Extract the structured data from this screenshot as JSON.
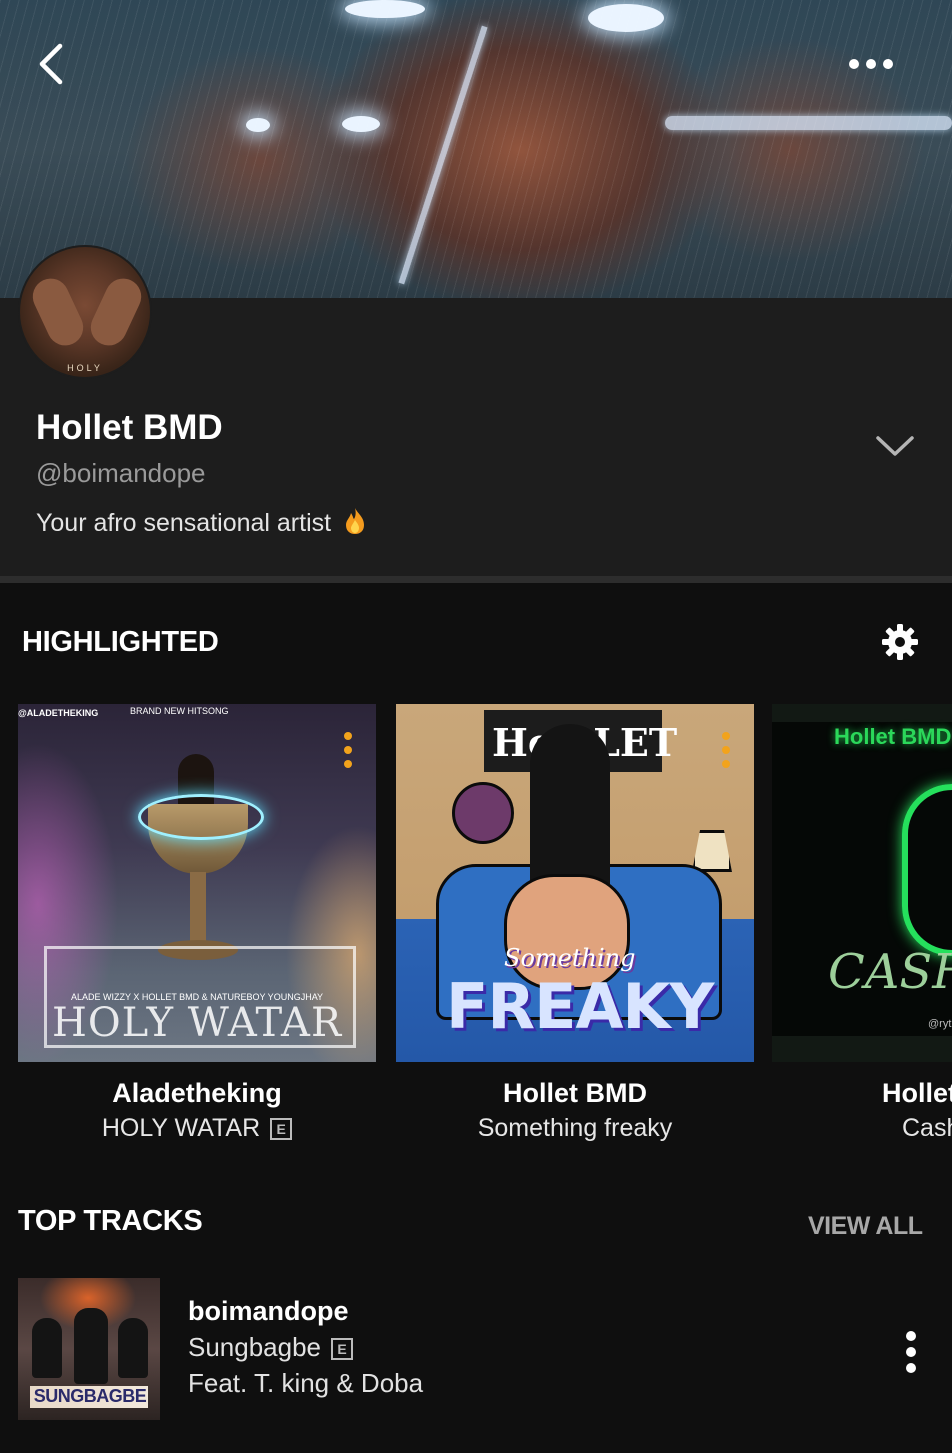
{
  "header": {
    "back_icon": "chevron-left-icon",
    "more_icon": "more-horizontal-icon"
  },
  "profile": {
    "name": "Hollet BMD",
    "handle": "@boimandope",
    "bio": "Your afro sensational artist",
    "bio_emoji": "fire-emoji",
    "avatar_text": "HOLY",
    "expand_icon": "chevron-down-icon"
  },
  "highlighted": {
    "title": "HIGHLIGHTED",
    "settings_icon": "gear-icon",
    "accent_color": "#f2a31c",
    "items": [
      {
        "artist": "Aladetheking",
        "title": "HOLY WATAR",
        "explicit": "E",
        "cover_text_main": "HOLY WATAR",
        "cover_text_credits": "ALADE WIZZY X HOLLET BMD & NATUREBOY YOUNGJHAY",
        "cover_text_top_left": "@ALADETHEKING",
        "cover_text_top": "BRAND NEW HITSONG"
      },
      {
        "artist": "Hollet BMD",
        "title": "Something freaky",
        "cover_text_sign": "Ho   LLET",
        "cover_text_small": "Something",
        "cover_text_main": "FREAKY"
      },
      {
        "artist": "Hollet",
        "title": "Cash",
        "cover_text_top": "Hollet BMD",
        "cover_text_main": "CASH",
        "cover_text_small": "@rythm"
      }
    ]
  },
  "top_tracks": {
    "title": "TOP TRACKS",
    "view_all": "VIEW ALL",
    "items": [
      {
        "artist": "boimandope",
        "title": "Sungbagbe",
        "explicit": "E",
        "feat": "Feat. T. king & Doba",
        "cover_text": "SUNGBAGBE",
        "menu_icon": "more-vertical-icon"
      }
    ]
  }
}
